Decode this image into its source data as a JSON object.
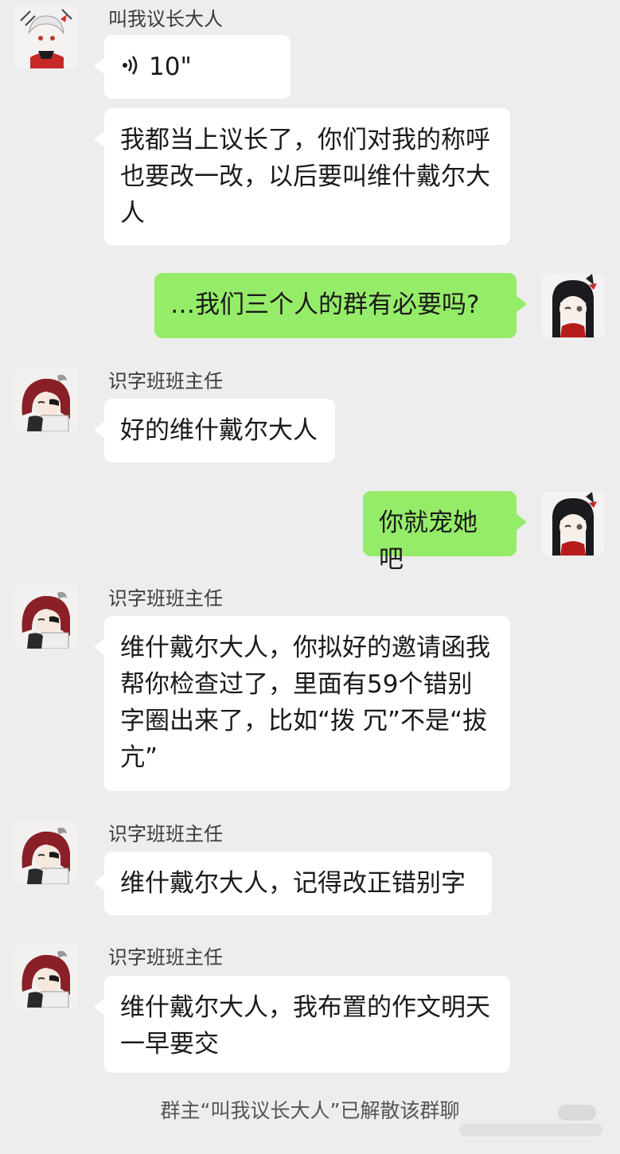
{
  "messages": [
    {
      "sender": "叫我议长大人",
      "type": "voice",
      "duration": "10\""
    },
    {
      "text": "我都当上议长了，你们对我的称呼也要改一改，以后要叫维什戴尔大人"
    },
    {
      "text": "…我们三个人的群有必要吗?"
    },
    {
      "sender": "识字班班主任",
      "text": "好的维什戴尔大人"
    },
    {
      "text": "你就宠她吧"
    },
    {
      "sender": "识字班班主任",
      "text": "维什戴尔大人，你拟好的邀请函我帮你检查过了，里面有59个错别字圈出来了，比如“拨 冗”不是“拔亢”"
    },
    {
      "sender": "识字班班主任",
      "text": "维什戴尔大人，记得改正错别字"
    },
    {
      "sender": "识字班班主任",
      "text": "维什戴尔大人，我布置的作文明天一早要交"
    }
  ],
  "system_notice": "群主“叫我议长大人”已解散该群聊",
  "colors": {
    "background": "#ededed",
    "self_bubble": "#95ec69",
    "other_bubble": "#ffffff"
  },
  "icons": {
    "voice": "voice-wave-icon"
  }
}
